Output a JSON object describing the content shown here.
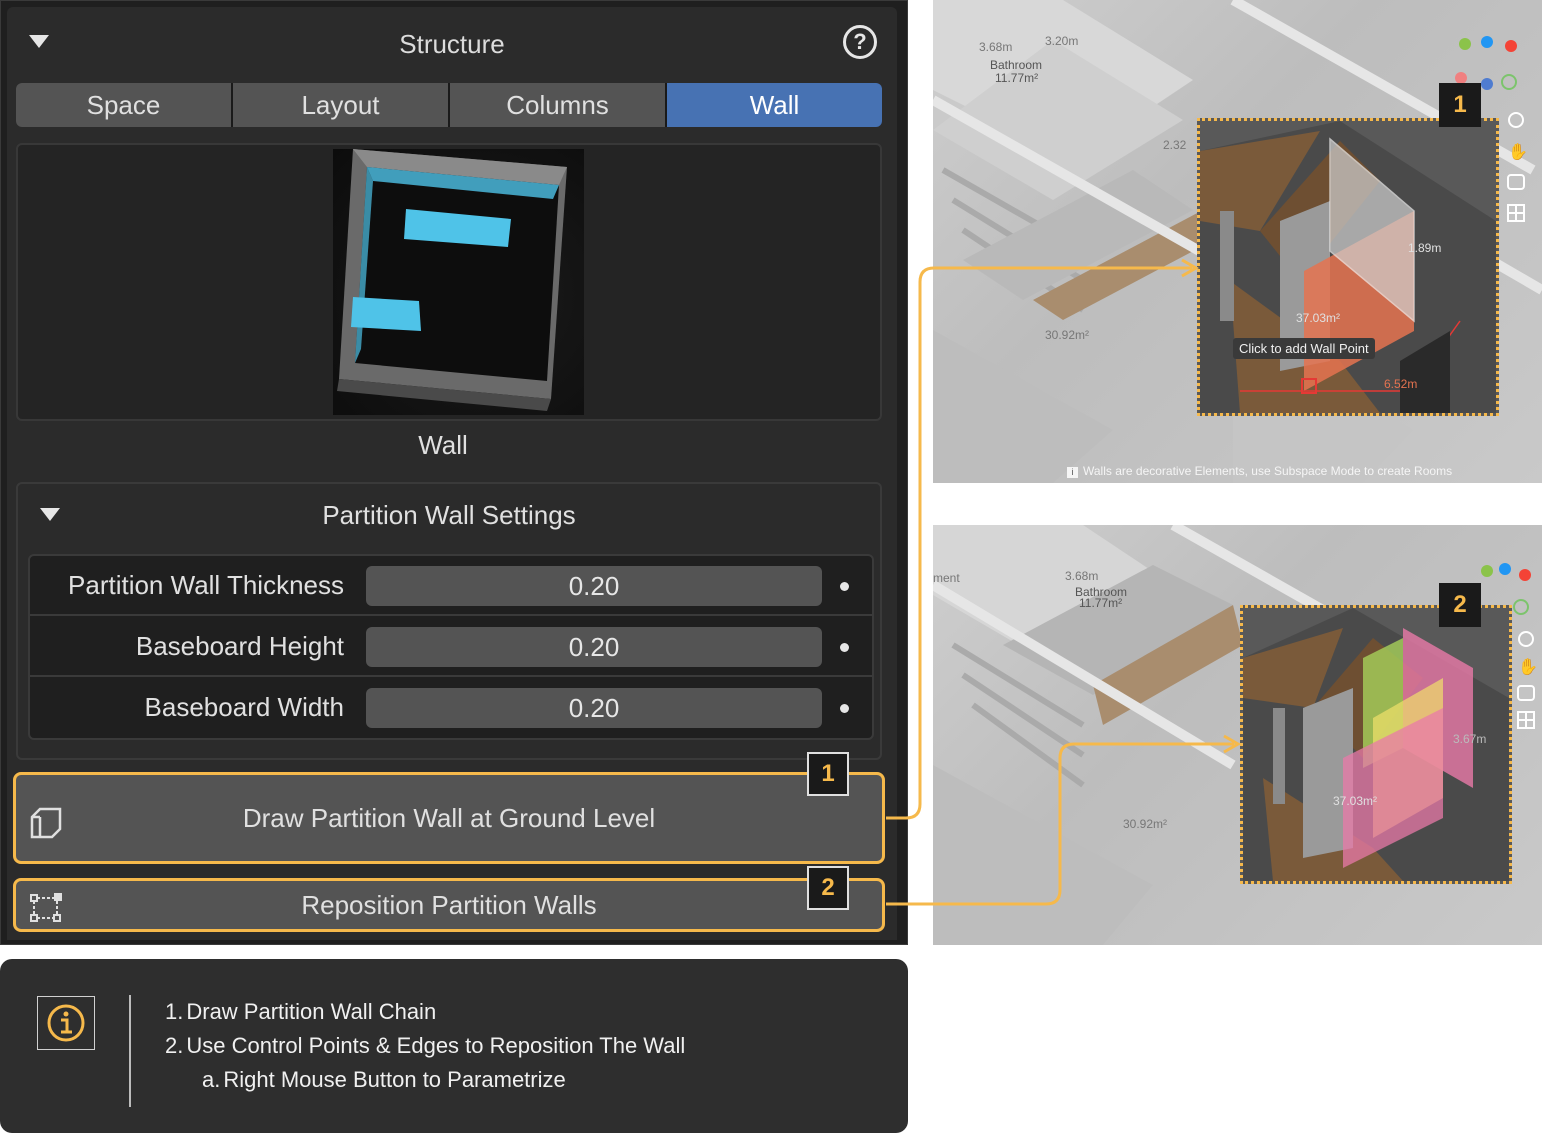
{
  "panel": {
    "title": "Structure",
    "help_icon": "question-circle-icon",
    "tabs": [
      {
        "label": "Space",
        "active": false
      },
      {
        "label": "Layout",
        "active": false
      },
      {
        "label": "Columns",
        "active": false
      },
      {
        "label": "Wall",
        "active": true
      }
    ],
    "preview_label": "Wall",
    "settings": {
      "title": "Partition Wall Settings",
      "rows": [
        {
          "label": "Partition Wall Thickness",
          "value": "0.20"
        },
        {
          "label": "Baseboard Height",
          "value": "0.20"
        },
        {
          "label": "Baseboard Width",
          "value": "0.20"
        }
      ]
    },
    "buttons": {
      "draw": {
        "label": "Draw Partition Wall at Ground Level",
        "badge": "1",
        "icon": "partition-wall-icon"
      },
      "reposition": {
        "label": "Reposition Partition Walls",
        "badge": "2",
        "icon": "control-points-icon"
      }
    }
  },
  "info": {
    "icon": "info-icon",
    "lines": [
      {
        "marker": "1.",
        "text": "Draw Partition Wall Chain"
      },
      {
        "marker": "2.",
        "text": "Use Control Points & Edges to Reposition The Wall"
      },
      {
        "marker": "a.",
        "text": "Right Mouse Button to Parametrize"
      }
    ]
  },
  "viewport1": {
    "badge": "1",
    "tooltip": "Click to add Wall Point",
    "room_label": "Bathroom",
    "room_area": "11.77m²",
    "dim_a": "3.68m",
    "dim_b": "3.20m",
    "dim_c": "2.32",
    "area_a": "30.92m²",
    "area_b": "37.03m²",
    "dim_wall": "1.89m",
    "dim_small": "6.52m",
    "status": "Walls are decorative Elements, use Subspace Mode to create Rooms"
  },
  "viewport2": {
    "badge": "2",
    "room_label": "Bathroom",
    "room_area": "11.77m²",
    "dim_a": "3.68m",
    "area_a": "30.92m²",
    "area_b": "37.03m²",
    "dim_b": "3.67m",
    "edge_text": "ment"
  },
  "colors": {
    "accent": "#f6b94b",
    "active_tab": "#4772b3",
    "panel_bg": "#2b2b2b",
    "field_bg": "#545454"
  }
}
